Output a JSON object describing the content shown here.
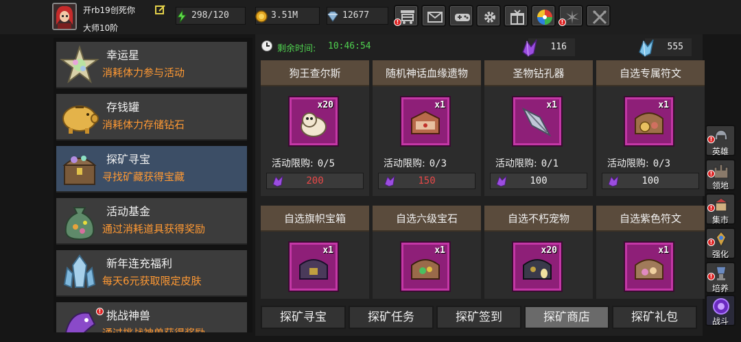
{
  "player": {
    "name": "开rb19创死你",
    "title": "大师10阶"
  },
  "resources": {
    "stamina": "298/120",
    "gold": "3.51M",
    "gems": "12677"
  },
  "toolbar": [
    {
      "icon": "shop-cart-icon",
      "badge": "!"
    },
    {
      "icon": "mail-icon",
      "badge": ""
    },
    {
      "icon": "gamepad-icon",
      "badge": ""
    },
    {
      "icon": "gear-icon",
      "badge": ""
    },
    {
      "icon": "gift-icon",
      "badge": ""
    },
    {
      "icon": "color-wheel-icon",
      "badge": ""
    },
    {
      "icon": "sparkle-icon",
      "badge": "!"
    },
    {
      "icon": "crossed-swords-icon",
      "badge": ""
    }
  ],
  "activities": [
    {
      "title": "幸运星",
      "desc": "消耗体力参与活动"
    },
    {
      "title": "存钱罐",
      "desc": "消耗体力存储钻石"
    },
    {
      "title": "探矿寻宝",
      "desc": "寻找矿藏获得宝藏"
    },
    {
      "title": "活动基金",
      "desc": "通过消耗道具获得奖励"
    },
    {
      "title": "新年连充福利",
      "desc": "每天6元获取限定皮肤"
    },
    {
      "title": "挑战神兽",
      "desc": "通过挑战神兽获得奖励"
    }
  ],
  "shop": {
    "timer_label": "剩余时间:",
    "timer_value": "10:46:54",
    "purple_crystals": "116",
    "blue_crystals": "555",
    "limit_label": "活动限购:",
    "items": [
      {
        "name": "狗王查尔斯",
        "qty": "x20",
        "limit": "0/5",
        "price": "200",
        "affordable": false
      },
      {
        "name": "随机神话血缘遗物",
        "qty": "x1",
        "limit": "0/3",
        "price": "150",
        "affordable": false
      },
      {
        "name": "圣物钻孔器",
        "qty": "x1",
        "limit": "0/1",
        "price": "100",
        "affordable": true
      },
      {
        "name": "自选专属符文",
        "qty": "x1",
        "limit": "0/3",
        "price": "100",
        "affordable": true
      },
      {
        "name": "自选旗帜宝箱",
        "qty": "x1"
      },
      {
        "name": "自选六级宝石",
        "qty": "x1"
      },
      {
        "name": "自选不朽宠物",
        "qty": "x20"
      },
      {
        "name": "自选紫色符文",
        "qty": "x1"
      }
    ]
  },
  "bottom_tabs": [
    "探矿寻宝",
    "探矿任务",
    "探矿签到",
    "探矿商店",
    "探矿礼包"
  ],
  "active_tab": "探矿商店",
  "side_menu": [
    {
      "label": "英雄",
      "badge": "!"
    },
    {
      "label": "领地",
      "badge": "!"
    },
    {
      "label": "集市",
      "badge": "!"
    },
    {
      "label": "强化",
      "badge": "!"
    },
    {
      "label": "培养",
      "badge": "!"
    },
    {
      "label": "战斗",
      "badge": ""
    }
  ],
  "colors": {
    "accent_green": "#4fd04f",
    "desc_orange": "#ff9933",
    "price_red": "#e84848",
    "item_frame": "#8e1f78",
    "selected_item": "#3c4e66"
  }
}
